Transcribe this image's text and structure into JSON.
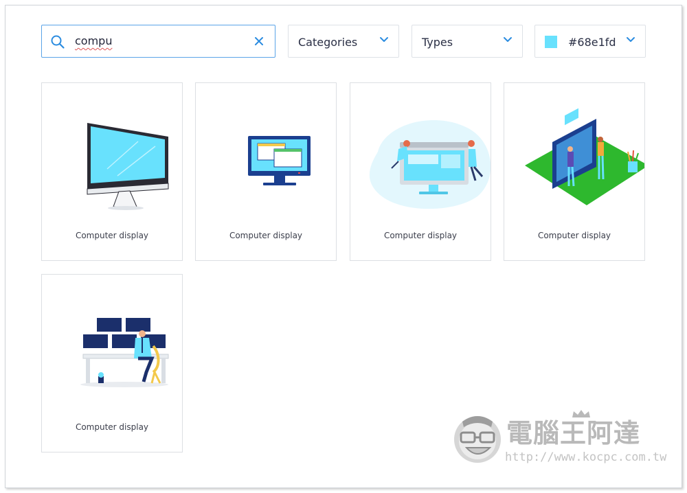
{
  "search": {
    "value": "compu",
    "icon": "search-icon",
    "clear_icon": "close-icon"
  },
  "filters": {
    "categories_label": "Categories",
    "types_label": "Types",
    "color_label": "#68e1fd",
    "color_swatch": "#68e1fd"
  },
  "results": [
    {
      "caption": "Computer display",
      "illustration": "imac-monitor"
    },
    {
      "caption": "Computer display",
      "illustration": "desktop-monitor-windows"
    },
    {
      "caption": "Computer display",
      "illustration": "people-around-monitor"
    },
    {
      "caption": "Computer display",
      "illustration": "isometric-screen-people"
    },
    {
      "caption": "Computer display",
      "illustration": "person-at-monitor-wall"
    }
  ],
  "watermark": {
    "brand": "電腦王阿達",
    "url": "http://www.kocpc.com.tw"
  },
  "colors": {
    "accent": "#68e1fd",
    "focus_border": "#5aa4e8",
    "icon_blue": "#2b8ce0",
    "navy": "#1b3f8f"
  }
}
